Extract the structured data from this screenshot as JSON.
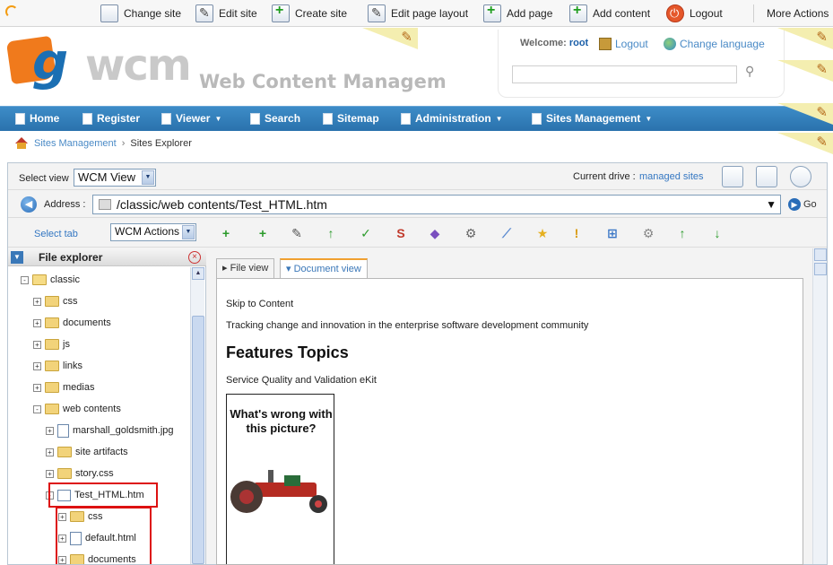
{
  "toolbar": {
    "change_site": "Change site",
    "edit_site": "Edit site",
    "create_site": "Create site",
    "edit_page_layout": "Edit page layout",
    "add_page": "Add page",
    "add_content": "Add content",
    "logout": "Logout",
    "more_actions": "More Actions"
  },
  "header": {
    "logo_mark": "g",
    "logo_text": "wcm",
    "logo_subtitle": "Web Content Managem",
    "welcome_label": "Welcome:",
    "username": "root",
    "logout_link": "Logout",
    "change_language": "Change language",
    "search_value": ""
  },
  "nav": {
    "home": "Home",
    "register": "Register",
    "viewer": "Viewer",
    "search": "Search",
    "sitemap": "Sitemap",
    "administration": "Administration",
    "sites_management": "Sites Management"
  },
  "breadcrumb": {
    "parent": "Sites Management",
    "current": "Sites Explorer"
  },
  "explorer": {
    "select_view_label": "Select view",
    "select_view_value": "WCM View",
    "current_drive_label": "Current drive :",
    "current_drive_value": "managed sites",
    "address_label": "Address :",
    "address_value": "/classic/web contents/Test_HTML.htm",
    "go_label": "Go",
    "select_tab_label": "Select tab",
    "actions_value": "WCM Actions"
  },
  "file_explorer": {
    "title": "File explorer",
    "nodes": [
      {
        "label": "classic"
      },
      {
        "label": "css"
      },
      {
        "label": "documents"
      },
      {
        "label": "js"
      },
      {
        "label": "links"
      },
      {
        "label": "medias"
      },
      {
        "label": "web contents"
      },
      {
        "label": "marshall_goldsmith.jpg"
      },
      {
        "label": "site artifacts"
      },
      {
        "label": "story.css"
      },
      {
        "label": "Test_HTML.htm"
      },
      {
        "label": "css"
      },
      {
        "label": "default.html"
      },
      {
        "label": "documents"
      }
    ]
  },
  "content": {
    "tab_file_view": "File view",
    "tab_document_view": "Document view",
    "skip": "Skip to Content",
    "tagline": "Tracking change and innovation in the enterprise software development community",
    "heading": "Features Topics",
    "subline": "Service Quality and Validation eKit",
    "ad_title": "What's wrong with this picture?"
  },
  "colors": {
    "nav_blue": "#2f7bb8",
    "link_blue": "#3a7fc4",
    "logo_orange": "#f07a1c",
    "highlight_red": "#dd1111"
  }
}
